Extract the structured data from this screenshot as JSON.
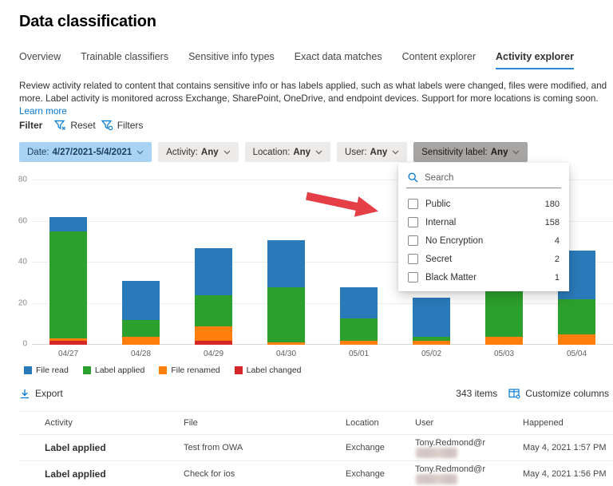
{
  "page": {
    "title": "Data classification"
  },
  "tabs": [
    {
      "label": "Overview",
      "active": false
    },
    {
      "label": "Trainable classifiers",
      "active": false
    },
    {
      "label": "Sensitive info types",
      "active": false
    },
    {
      "label": "Exact data matches",
      "active": false
    },
    {
      "label": "Content explorer",
      "active": false
    },
    {
      "label": "Activity explorer",
      "active": true
    }
  ],
  "description": {
    "text": "Review activity related to content that contains sensitive info or has labels applied, such as what labels were changed, files were modified, and more. Label activity is monitored across Exchange, SharePoint, OneDrive, and endpoint devices. Support for more locations is coming soon.",
    "link_label": "Learn more"
  },
  "filter_bar": {
    "label": "Filter",
    "reset_label": "Reset",
    "filters_label": "Filters"
  },
  "filter_pills": [
    {
      "label": "Date:",
      "value": "4/27/2021-5/4/2021",
      "style": "date"
    },
    {
      "label": "Activity:",
      "value": "Any",
      "style": ""
    },
    {
      "label": "Location:",
      "value": "Any",
      "style": ""
    },
    {
      "label": "User:",
      "value": "Any",
      "style": ""
    },
    {
      "label": "Sensitivity label:",
      "value": "Any",
      "style": "open"
    }
  ],
  "sensitivity_dropdown": {
    "search_placeholder": "Search",
    "options": [
      {
        "label": "Public",
        "count": "180"
      },
      {
        "label": "Internal",
        "count": "158"
      },
      {
        "label": "No Encryption",
        "count": "4"
      },
      {
        "label": "Secret",
        "count": "2"
      },
      {
        "label": "Black Matter",
        "count": "1"
      }
    ]
  },
  "chart_data": {
    "type": "bar",
    "stacked": true,
    "categories": [
      "04/27",
      "04/28",
      "04/29",
      "04/30",
      "05/01",
      "05/02",
      "05/03",
      "05/04"
    ],
    "series": [
      {
        "name": "File read",
        "color": "#2a7ab9",
        "values": [
          7,
          19,
          23,
          23,
          15,
          19,
          4,
          24
        ]
      },
      {
        "name": "Label applied",
        "color": "#2ca02c",
        "values": [
          52,
          8,
          15,
          27,
          11,
          2,
          24,
          17
        ]
      },
      {
        "name": "File renamed",
        "color": "#ff7f0e",
        "values": [
          1,
          4,
          7,
          1,
          2,
          2,
          4,
          5
        ]
      },
      {
        "name": "Label changed",
        "color": "#d62728",
        "values": [
          2,
          0,
          2,
          0,
          0,
          0,
          0,
          0
        ]
      }
    ],
    "stack_bottom_to_top": [
      "Label changed",
      "File renamed",
      "Label applied",
      "File read"
    ],
    "totals": [
      62,
      31,
      47,
      51,
      28,
      23,
      32,
      46
    ],
    "ylim": [
      0,
      80
    ],
    "yticks": [
      0,
      20,
      40,
      60,
      80
    ],
    "grid": true,
    "legend_position": "bottom-left"
  },
  "toolbar": {
    "export_label": "Export",
    "items_count": "343 items",
    "customize_label": "Customize columns"
  },
  "table": {
    "columns": [
      "Activity",
      "File",
      "Location",
      "User",
      "Happened"
    ],
    "rows": [
      {
        "activity": "Label applied",
        "file": "Test from OWA",
        "location": "Exchange",
        "user": "Tony.Redmond@r",
        "user_redacted": true,
        "happened": "May 4, 2021 1:57 PM"
      },
      {
        "activity": "Label applied",
        "file": "Check for ios",
        "location": "Exchange",
        "user": "Tony.Redmond@r",
        "user_redacted": true,
        "happened": "May 4, 2021 1:56 PM"
      }
    ]
  },
  "colors": {
    "accent": "#0078d4",
    "tab_underline": "#2b88d8",
    "date_pill_bg": "#a9d3f2",
    "pill_bg": "#edebe9",
    "open_pill_bg": "#a7a5a3",
    "arrow_red": "#e53e47"
  }
}
